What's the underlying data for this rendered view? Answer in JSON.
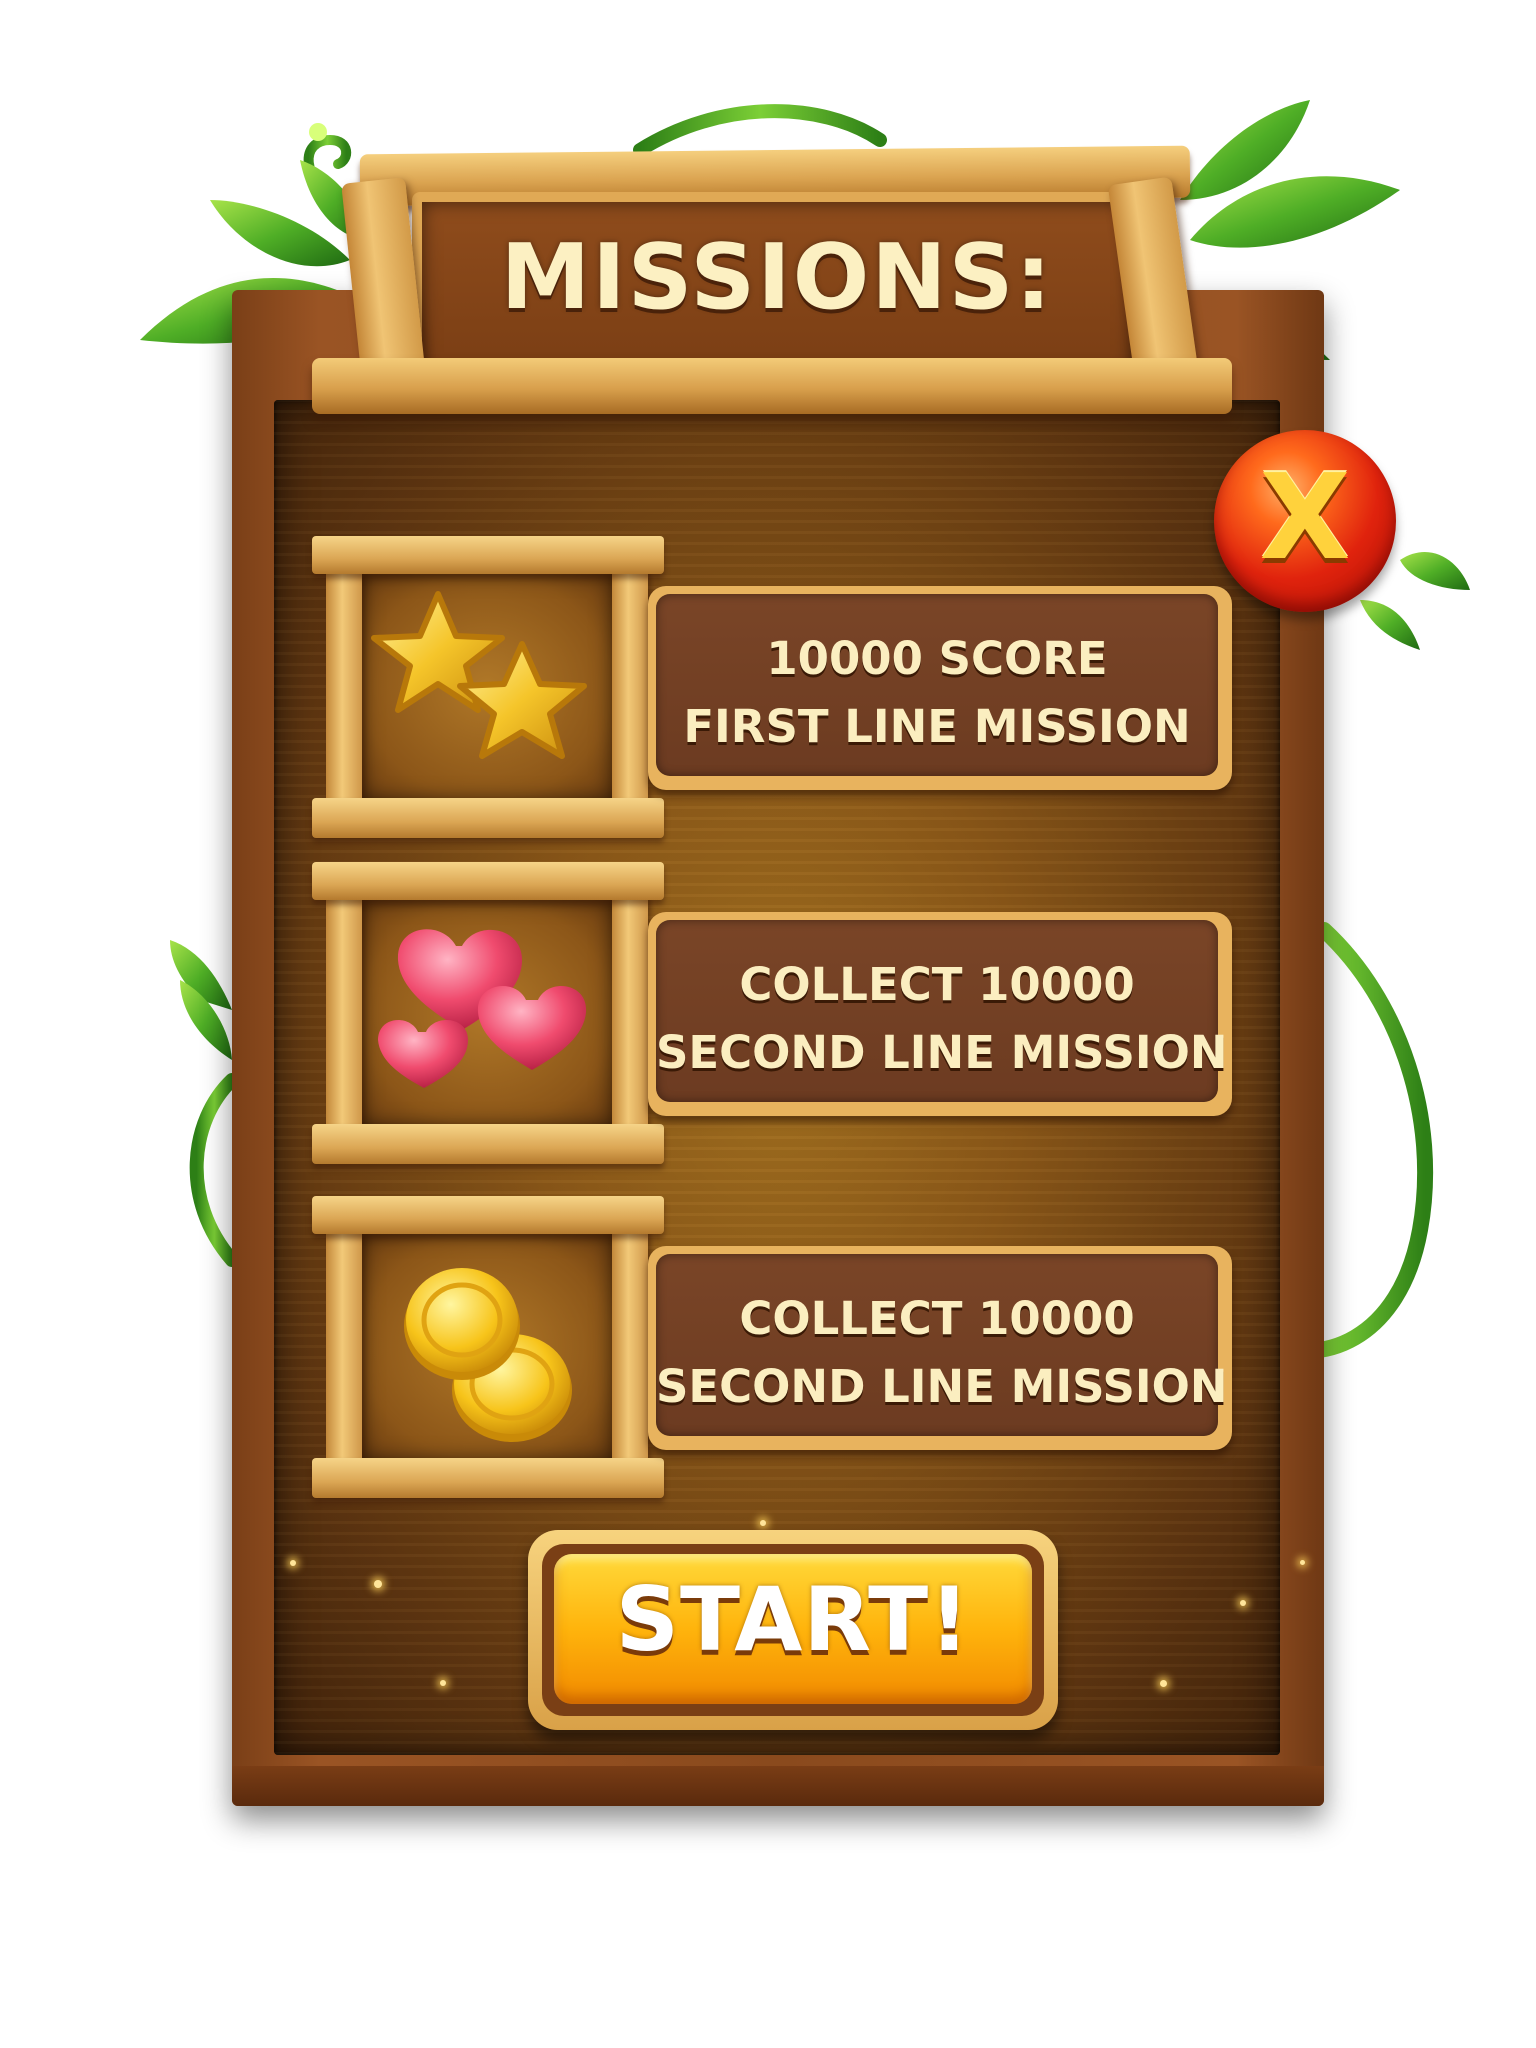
{
  "header": {
    "title": "MISSIONS:"
  },
  "close_button": {
    "label": "X"
  },
  "missions": [
    {
      "icon": "stars-icon",
      "line1": "10000 SCORE",
      "line2": "FIRST LINE MISSION"
    },
    {
      "icon": "hearts-icon",
      "line1": "COLLECT 10000",
      "line2": "SECOND LINE MISSION"
    },
    {
      "icon": "coins-icon",
      "line1": "COLLECT 10000",
      "line2": "SECOND LINE MISSION"
    }
  ],
  "start_button": {
    "label": "START!"
  },
  "colors": {
    "panel_wood": "#8a4a1d",
    "plank_light": "#e0a955",
    "text_cream": "#fbeec0",
    "close_red": "#e0230d",
    "start_orange": "#ffb40c",
    "vine_green": "#4fae26"
  }
}
